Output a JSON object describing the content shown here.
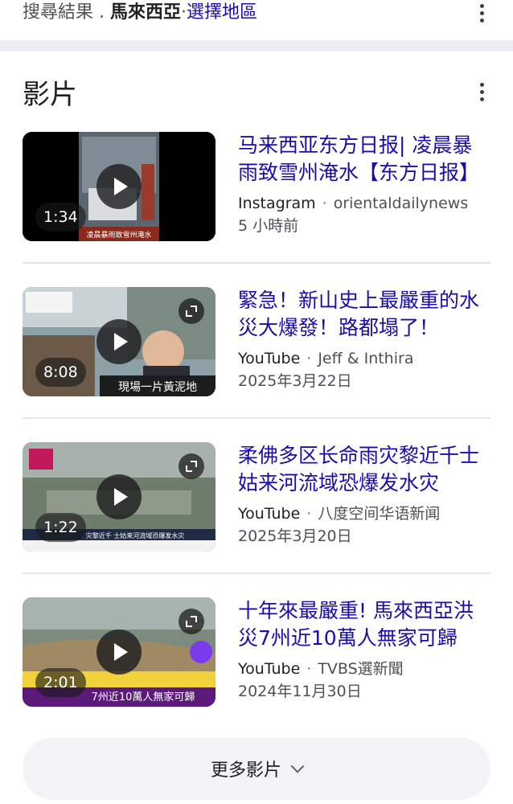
{
  "location_bar": {
    "prefix": "搜尋結果",
    "separator": ".",
    "location": "馬來西亞",
    "dot": "·",
    "choose_region": "選擇地區"
  },
  "section": {
    "title": "影片"
  },
  "videos": [
    {
      "title": "马来西亚东方日报| 凌晨暴雨致雪州淹水【东方日报】",
      "platform": "Instagram",
      "channel": "orientaldailynews",
      "date": "5 小時前",
      "duration": "1:34",
      "thumb_caption": "凌晨暴雨致雪州淹水"
    },
    {
      "title": "緊急！新山史上最嚴重的水災大爆發！路都塌了！",
      "platform": "YouTube",
      "channel": "Jeff & Inthira",
      "date": "2025年3月22日",
      "duration": "8:08",
      "thumb_caption": "現場一片黃泥地"
    },
    {
      "title": "柔佛多区长命雨灾黎近千士姑来河流域恐爆发水灾",
      "platform": "YouTube",
      "channel": "八度空间华语新闻",
      "date": "2025年3月20日",
      "duration": "1:22",
      "thumb_caption": "灾黎近千 士姑来河流域恐爆发水灾"
    },
    {
      "title": "十年來最嚴重! 馬來西亞洪災7州近10萬人無家可歸",
      "platform": "YouTube",
      "channel": "TVBS選新聞",
      "date": "2024年11月30日",
      "duration": "2:01",
      "thumb_caption": "7州近10萬人無家可歸"
    }
  ],
  "more_button": {
    "label": "更多影片"
  },
  "colors": {
    "link": "#1a0dab",
    "band": "#eceff1",
    "button_bg": "#f1f3f4"
  }
}
